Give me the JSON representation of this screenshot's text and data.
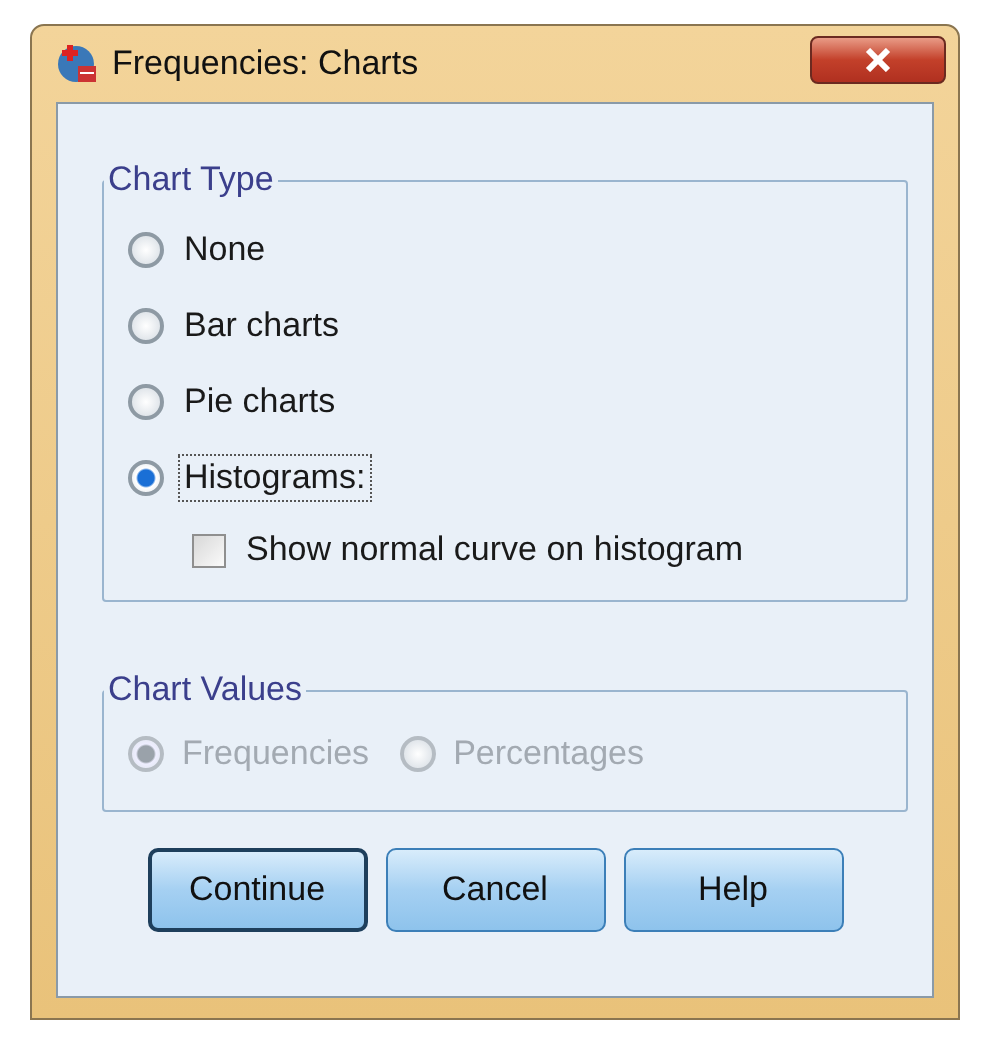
{
  "window": {
    "title": "Frequencies: Charts"
  },
  "chart_type": {
    "title": "Chart Type",
    "options": [
      {
        "label": "None",
        "selected": false
      },
      {
        "label": "Bar charts",
        "selected": false
      },
      {
        "label": "Pie charts",
        "selected": false
      },
      {
        "label": "Histograms:",
        "selected": true
      }
    ],
    "show_normal_curve": {
      "label": "Show normal curve on histogram",
      "checked": false
    }
  },
  "chart_values": {
    "title": "Chart Values",
    "disabled": true,
    "options": [
      {
        "label": "Frequencies",
        "selected": true
      },
      {
        "label": "Percentages",
        "selected": false
      }
    ]
  },
  "buttons": [
    {
      "label": "Continue",
      "default": true
    },
    {
      "label": "Cancel",
      "default": false
    },
    {
      "label": "Help",
      "default": false
    }
  ]
}
